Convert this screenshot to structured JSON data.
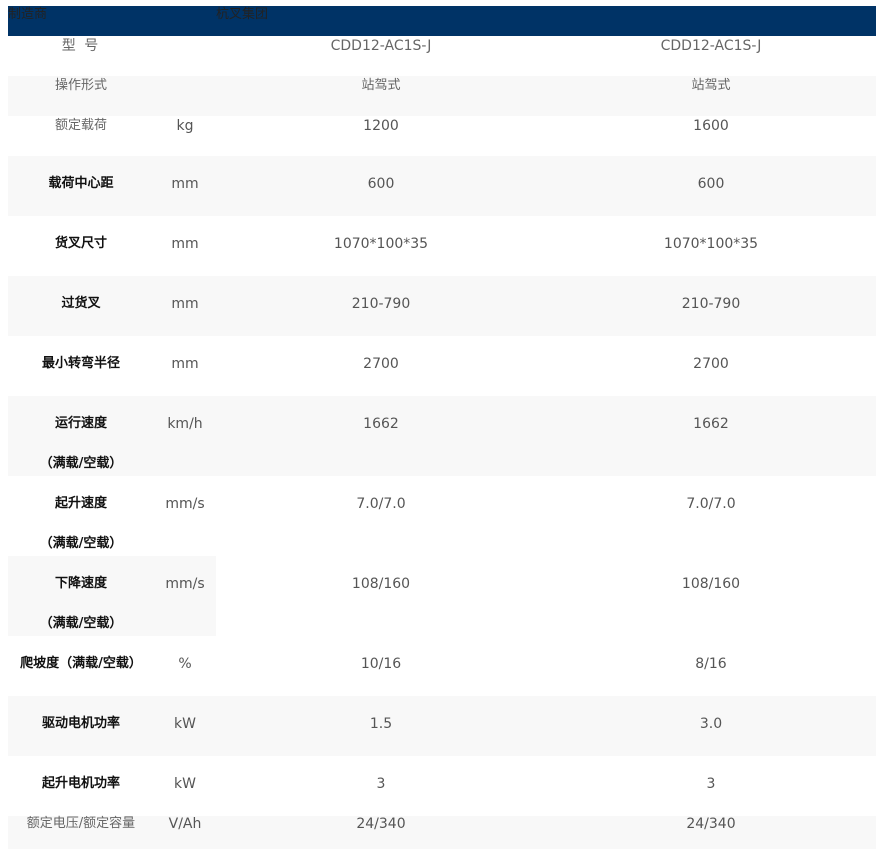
{
  "header": {
    "col1": "制造商",
    "col2": "杭叉集团"
  },
  "model_row": {
    "label": "型 号",
    "unit": "",
    "values": [
      "CDD12-AC1S-J",
      "CDD12-AC1S-J"
    ]
  },
  "rows": [
    {
      "label": "操作形式",
      "label2": "",
      "unit": "",
      "v1": "站驾式",
      "v2": "站驾式"
    },
    {
      "label": "额定载荷",
      "label2": "",
      "unit": "kg",
      "v1": "1200",
      "v2": "1600"
    },
    {
      "label": "载荷中心距",
      "label2": "",
      "unit": "mm",
      "v1": "600",
      "v2": "600"
    },
    {
      "label": "货叉尺寸",
      "label2": "",
      "unit": "mm",
      "v1": "1070*100*35",
      "v2": "1070*100*35"
    },
    {
      "label": "过货叉",
      "label2": "",
      "unit": "mm",
      "v1": "210-790",
      "v2": "210-790"
    },
    {
      "label": "最小转弯半径",
      "label2": "",
      "unit": "mm",
      "v1": "2700",
      "v2": "2700"
    },
    {
      "label": "运行速度",
      "label2": "（满载/空载）",
      "unit": "km/h",
      "v1": "1662",
      "v2": "1662"
    },
    {
      "label": "起升速度",
      "label2": "（满载/空载）",
      "unit": "mm/s",
      "v1": "7.0/7.0",
      "v2": "7.0/7.0"
    },
    {
      "label": "下降速度",
      "label2": "（满载/空载）",
      "unit": "mm/s",
      "v1": "108/160",
      "v2": "108/160"
    },
    {
      "label": "爬坡度（满载/空载）",
      "label2": "",
      "unit": "%",
      "v1": "10/16",
      "v2": "8/16"
    },
    {
      "label": "驱动电机功率",
      "label2": "",
      "unit": "kW",
      "v1": "1.5",
      "v2": "3.0"
    },
    {
      "label": "起升电机功率",
      "label2": "",
      "unit": "kW",
      "v1": "3",
      "v2": "3"
    },
    {
      "label": "额定电压/额定容量",
      "label2": "",
      "unit": "V/Ah",
      "v1": "24/340",
      "v2": "24/340"
    }
  ]
}
